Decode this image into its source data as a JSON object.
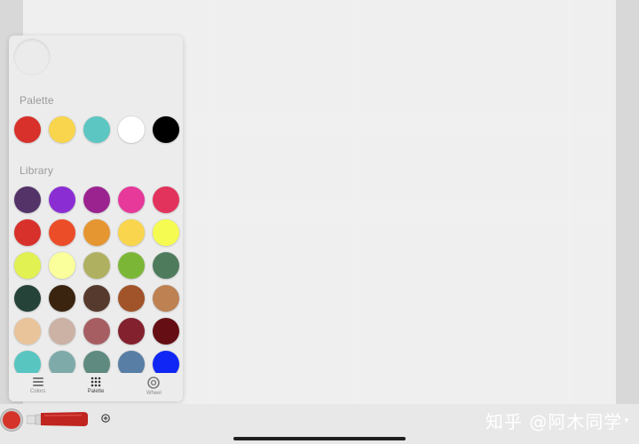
{
  "popover": {
    "current_color": "#ebebeb",
    "palette_title": "Palette",
    "library_title": "Library",
    "palette": [
      "#d8302a",
      "#f8d54c",
      "#5cc6c2",
      "#ffffff",
      "#000000"
    ],
    "library": [
      "#533368",
      "#8a2ed4",
      "#9b2390",
      "#e6399a",
      "#e2335c",
      "#d8302a",
      "#ec4d29",
      "#e69630",
      "#f8d54c",
      "#f6fb52",
      "#e1f152",
      "#faff9b",
      "#b0b061",
      "#7cb637",
      "#4f7b5d",
      "#26433a",
      "#3a2410",
      "#563a2d",
      "#a1532a",
      "#bd8152",
      "#e9c39a",
      "#cbb2a5",
      "#a75e63",
      "#83212e",
      "#650f14",
      "#58c5c1",
      "#7eaaaa",
      "#5e8a7f",
      "#587ea5",
      "#1026f4"
    ],
    "tabs": [
      {
        "label": "Colors",
        "icon": "layers-icon"
      },
      {
        "label": "Palette",
        "icon": "grid-dots-icon"
      },
      {
        "label": "Wheel",
        "icon": "color-wheel-icon"
      }
    ]
  },
  "toolbar": {
    "current_color": "#d5342a",
    "tube_color": "#c0251f",
    "tube_label": "",
    "watermark": "知乎 @阿木同学"
  }
}
